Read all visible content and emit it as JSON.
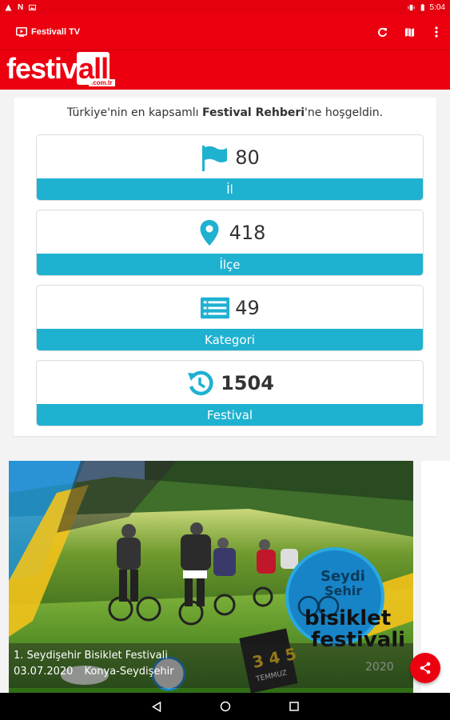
{
  "status_bar": {
    "time": "5:04",
    "icons": [
      "alert-icon",
      "n-icon",
      "image-icon",
      "vibrate-icon",
      "battery-icon"
    ]
  },
  "app_bar": {
    "title": "Festivall TV",
    "icons": [
      "tv-icon",
      "refresh-icon",
      "map-icon",
      "more-vert-icon"
    ]
  },
  "logo": {
    "main": "festiv",
    "accent": "all",
    "domain": ".com.tr"
  },
  "welcome": {
    "prefix": "Türkiye'nin en kapsamlı ",
    "bold": "Festival Rehberi",
    "suffix": "'ne hoşgeldin."
  },
  "stats": [
    {
      "value": "80",
      "label": "İl",
      "icon": "flag-icon"
    },
    {
      "value": "418",
      "label": "İlçe",
      "icon": "location-pin-icon"
    },
    {
      "value": "49",
      "label": "Kategori",
      "icon": "list-icon"
    },
    {
      "value": "1504",
      "label": "Festival",
      "icon": "history-icon"
    }
  ],
  "banner": {
    "title": "1. Seydişehir Bisiklet Festivali",
    "date": "03.07.2020",
    "location": "Konya-Seydişehir",
    "art_text": {
      "line1": "Seydi",
      "line2": "Şehir",
      "line3": "bisiklet",
      "line4": "festivali",
      "year": "2020",
      "dates": "3 4 5",
      "month": "TEMMUZ"
    }
  },
  "colors": {
    "brand_red": "#ec0010",
    "accent_cyan": "#1fb1d0"
  },
  "nav": {
    "icons": [
      "back-icon",
      "home-icon",
      "recents-icon"
    ]
  }
}
